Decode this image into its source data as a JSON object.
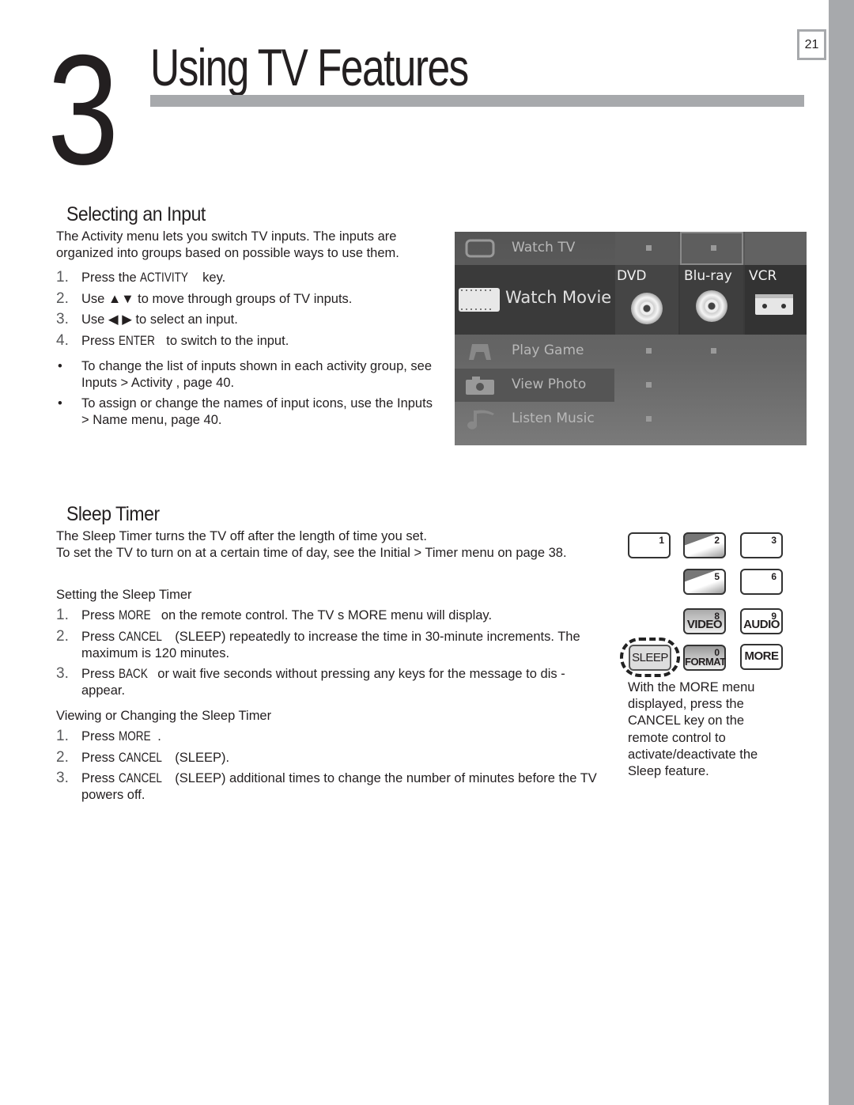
{
  "page_number": "21",
  "chapter": {
    "number": "3",
    "title": "Using TV Features"
  },
  "section1": {
    "heading": "Selecting an Input",
    "intro": "The Activity  menu lets you switch TV inputs.  The inputs are organized into groups based on possible ways to use them.",
    "steps": [
      {
        "n": "1.",
        "pre": "Press the ",
        "key": "ACTIVITY",
        "post": " key."
      },
      {
        "n": "2.",
        "pre": "Use ▲▼ to move through groups of TV inputs.",
        "key": "",
        "post": ""
      },
      {
        "n": "3.",
        "pre": "Use ◀ ▶ to select an input.",
        "key": "",
        "post": ""
      },
      {
        "n": "4.",
        "pre": "Press ",
        "key": "ENTER",
        "post": " to switch to the input."
      }
    ],
    "bullets": [
      "To change the list of inputs shown in each activity group, see Inputs > Activity  , page 40.",
      "To assign or change the names of input icons, use the Inputs  > Name  menu, page 40."
    ]
  },
  "tv_menu": {
    "rows": [
      {
        "label": "Watch TV",
        "icon": "tv-icon"
      },
      {
        "label": "Watch Movie",
        "icon": "film-icon",
        "sources": [
          "DVD",
          "Blu-ray",
          "VCR"
        ]
      },
      {
        "label": "Play Game",
        "icon": "gamepad-icon"
      },
      {
        "label": "View Photo",
        "icon": "camera-icon"
      },
      {
        "label": "Listen Music",
        "icon": "music-note-icon"
      }
    ]
  },
  "section2": {
    "heading": "Sleep Timer",
    "intro1": "The Sleep Timer turns the TV off after the length of time you set.",
    "intro2": "To set the TV to turn on at a certain time of day, see the Initial > Timer menu on page 38.",
    "sub1": "Setting the Sleep Timer",
    "steps1": [
      {
        "n": "1.",
        "pre": "Press ",
        "key": "MORE",
        "post": " on the remote control. The TV s MORE  menu will display."
      },
      {
        "n": "2.",
        "pre": "Press ",
        "key": "CANCEL",
        "post": " (SLEEP) repeatedly to increase the time in 30-minute increments. The maximum is 120 minutes."
      },
      {
        "n": "3.",
        "pre": "Press ",
        "key": "BACK",
        "post": " or wait five seconds without pressing any keys for the message to dis - appear."
      }
    ],
    "sub2": "Viewing or Changing the Sleep Timer",
    "steps2": [
      {
        "n": "1.",
        "pre": "Press ",
        "key": "MORE",
        "post": "."
      },
      {
        "n": "2.",
        "pre": "Press ",
        "key": "CANCEL",
        "post": " (SLEEP)."
      },
      {
        "n": "3.",
        "pre": "Press ",
        "key": "CANCEL",
        "post": " (SLEEP) additional times to change the number of minutes before the TV powers off."
      }
    ]
  },
  "remote": {
    "keys": {
      "k1": "1",
      "k2": "2",
      "k3": "3",
      "k5": "5",
      "k6": "6",
      "k8": "8",
      "k9": "9",
      "k0": "0",
      "video": "VIDEO",
      "audio": "AUDIO",
      "format": "FORMAT",
      "more": "MORE",
      "sleep": "SLEEP"
    },
    "caption": "With the MORE menu displayed, press the CANCEL key on the remote control to activate/deactivate the Sleep feature."
  }
}
